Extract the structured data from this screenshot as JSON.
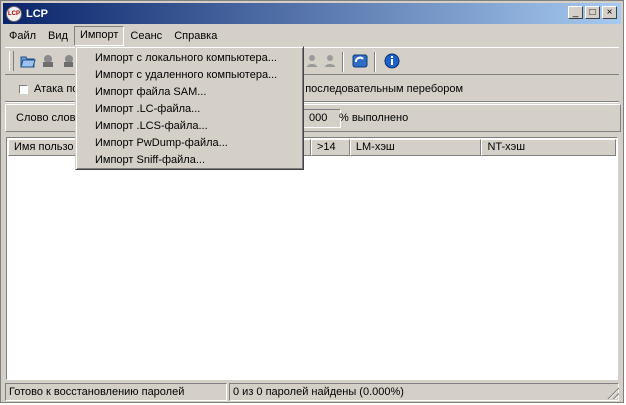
{
  "window": {
    "title": "LCP",
    "app_icon": "lcp-logo-icon"
  },
  "window_buttons": {
    "minimize": "_",
    "maximize": "□",
    "close": "×"
  },
  "menu": {
    "items": [
      {
        "label": "Файл"
      },
      {
        "label": "Вид"
      },
      {
        "label": "Импорт",
        "active": true
      },
      {
        "label": "Сеанс"
      },
      {
        "label": "Справка"
      }
    ]
  },
  "dropdown": {
    "items": [
      "Импорт с локального компьютера...",
      "Импорт с удаленного компьютера...",
      "Импорт файла SAM...",
      "Импорт .LC-файла...",
      "Импорт .LCS-файла...",
      "Импорт PwDump-файла...",
      "Импорт Sniff-файла..."
    ]
  },
  "toolbar": {
    "icons": [
      "open-folder-icon",
      "import-icon",
      "import-icon",
      "user-icon",
      "user-icon",
      "refresh-icon",
      "info-icon"
    ]
  },
  "options": {
    "attack_label": "Атака по",
    "brute_label": "ка последовательным перебором",
    "checkbox_checked": false
  },
  "progress": {
    "word_label": "Слово слов",
    "percent_value": "000",
    "percent_suffix": "% выполнено"
  },
  "table": {
    "columns": [
      "Имя пользо",
      ">14",
      "LM-хэш",
      "NT-хэш"
    ],
    "rows": []
  },
  "status": {
    "left": "Готово к восстановлению паролей",
    "right": "0 из 0 паролей найдены (0.000%)"
  }
}
